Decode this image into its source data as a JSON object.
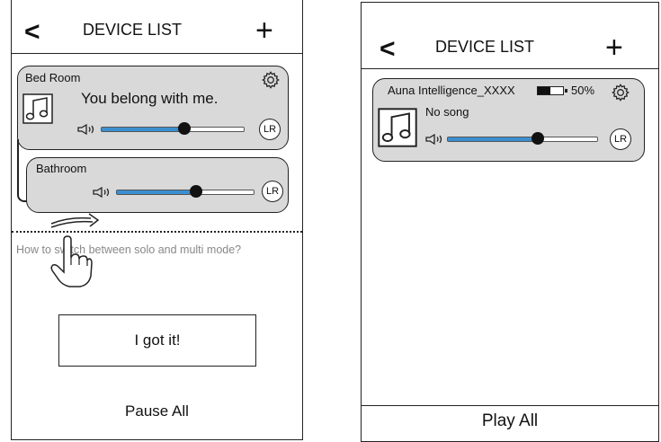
{
  "left_screen": {
    "header": {
      "back_icon": "<",
      "title": "DEVICE LIST",
      "add_icon": "+"
    },
    "device_card": {
      "name": "Bed Room",
      "song": "You belong with me.",
      "volume_level": 0.58,
      "channel_label": "LR"
    },
    "grouped_card": {
      "name": "Bathroom",
      "volume_level": 0.58,
      "channel_label": "LR"
    },
    "hint_text": "How to switch between solo and multi mode?",
    "got_it_label": "I got it!",
    "pause_all_label": "Pause All"
  },
  "right_screen": {
    "header": {
      "back_icon": "<",
      "title": "DEVICE LIST",
      "add_icon": "+"
    },
    "device_card": {
      "name": "Auna Intelligence_XXXX",
      "battery_percent": "50%",
      "battery_level": 0.5,
      "song": "No song",
      "volume_level": 0.6,
      "channel_label": "LR"
    },
    "play_all_label": "Play All"
  },
  "icons": {
    "settings": "gear-icon",
    "music": "music-note-icon",
    "speaker": "speaker-icon",
    "battery": "battery-icon",
    "hand": "hand-pointer-icon",
    "swipe": "swipe-arrow-icon"
  },
  "colors": {
    "slider_fill": "#3b8fd0",
    "card_bg": "#d9d9d9",
    "hint": "#888888"
  }
}
